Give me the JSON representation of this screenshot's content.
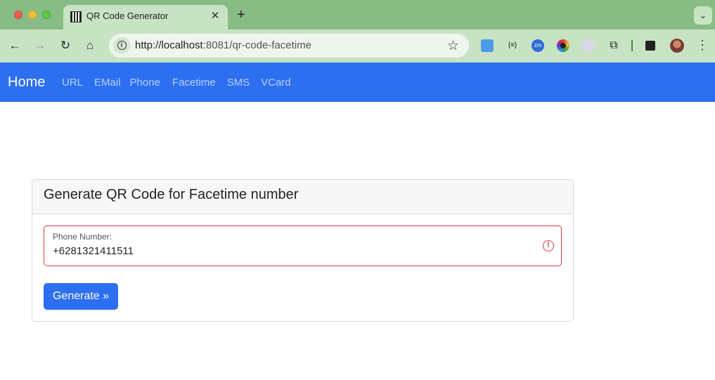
{
  "browser": {
    "tab_title": "QR Code Generator",
    "tab_close": "✕",
    "new_tab": "+",
    "tab_menu": "⌄",
    "url_host": "http://localhost",
    "url_rest": ":8081/qr-code-facetime",
    "back": "←",
    "forward": "→",
    "reload": "↻",
    "home": "⌂",
    "bookmark": "☆",
    "extensions": {
      "json_label": "{≡}",
      "zoom_label": "zm"
    },
    "menu": "⋮"
  },
  "navbar": {
    "brand": "Home",
    "links": [
      "URL",
      "EMail",
      "Phone",
      "Facetime",
      "SMS",
      "VCard"
    ]
  },
  "card": {
    "title": "Generate QR Code for Facetime number",
    "field_label": "Phone Number:",
    "field_value": "+6281321411511",
    "error_glyph": "!",
    "button": "Generate »"
  },
  "colors": {
    "tabstrip": "#87bd84",
    "toolbar": "#c8e3c4",
    "navbar": "#2c6ff0",
    "error": "#d33a3a"
  }
}
